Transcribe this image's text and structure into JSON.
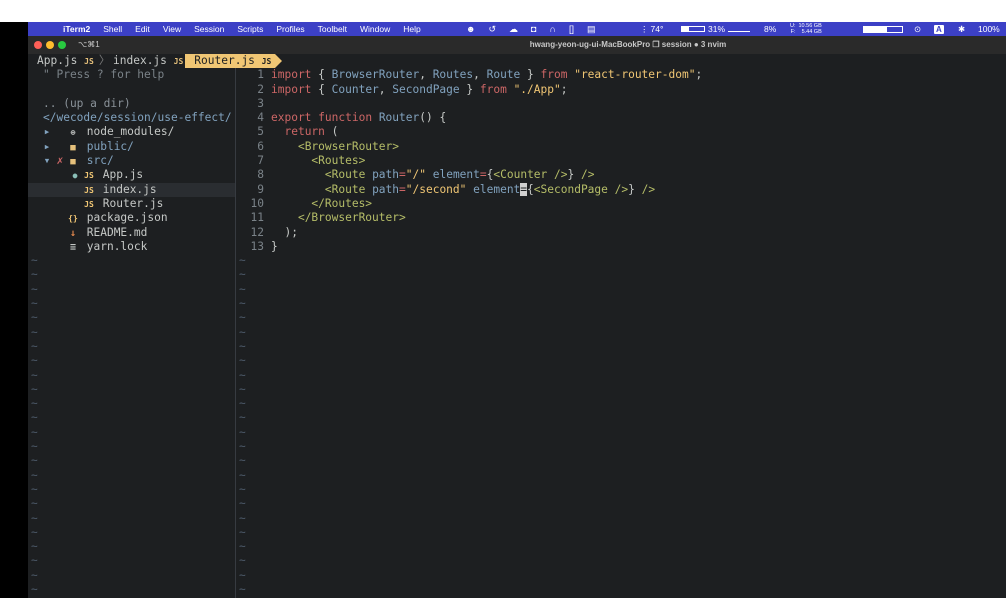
{
  "menubar": {
    "apple": "",
    "app": "iTerm2",
    "items": [
      "Shell",
      "Edit",
      "View",
      "Session",
      "Scripts",
      "Profiles",
      "Toolbelt",
      "Window",
      "Help"
    ],
    "temperature": "74°",
    "cpu": "31%",
    "cpu_fill": 0.31,
    "battery_small": "8%",
    "mem_top": "10.56 GB",
    "mem_bottom": "5.44 GB",
    "ul_label": "U:",
    "dl_label": "F:",
    "input_source": "A",
    "battery": "100%"
  },
  "titlebar": {
    "shortcut": "⌥⌘1",
    "title": "hwang-yeon-ug-ui-MacBookPro ❐ session ● 3 nvim"
  },
  "tabs": [
    {
      "label": "App.js",
      "icon": "JS",
      "active": false
    },
    {
      "label": "index.js",
      "icon": "JS",
      "active": false
    },
    {
      "label": "Router.js",
      "icon": "JS",
      "active": true
    }
  ],
  "tree": {
    "help": "\" Press ? for help",
    "updir": ".. (up a dir)",
    "cwd": "</wecode/session/use-effect/",
    "entries": [
      {
        "name": "node_modules/",
        "type": "dir-node",
        "indent": 0
      },
      {
        "name": "public/",
        "type": "dir",
        "indent": 0
      },
      {
        "name": "src/",
        "type": "dir-open",
        "indent": 0
      },
      {
        "name": "App.js",
        "type": "js",
        "indent": 1
      },
      {
        "name": "index.js",
        "type": "js",
        "indent": 1
      },
      {
        "name": "Router.js",
        "type": "js",
        "indent": 1
      },
      {
        "name": "package.json",
        "type": "json",
        "indent": 0
      },
      {
        "name": "README.md",
        "type": "md",
        "indent": 0
      },
      {
        "name": "yarn.lock",
        "type": "lock",
        "indent": 0
      }
    ],
    "tilde": "~"
  },
  "code": {
    "lines": [
      "import { BrowserRouter, Routes, Route } from \"react-router-dom\";",
      "import { Counter, SecondPage } from \"./App\";",
      "",
      "export function Router() {",
      "  return (",
      "    <BrowserRouter>",
      "      <Routes>",
      "        <Route path=\"/\" element={<Counter />} />",
      "        <Route path=\"/second\" element={<SecondPage />} />",
      "      </Routes>",
      "    </BrowserRouter>",
      "  );",
      "}"
    ],
    "tilde": "~"
  }
}
